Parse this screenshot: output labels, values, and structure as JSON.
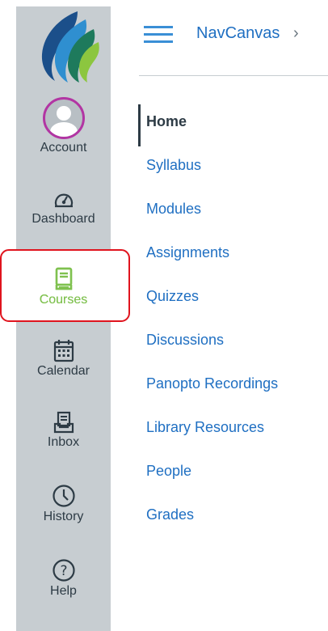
{
  "global_nav": {
    "account": {
      "label": "Account",
      "icon": "avatar-icon"
    },
    "dashboard": {
      "label": "Dashboard",
      "icon": "speedometer-icon"
    },
    "courses": {
      "label": "Courses",
      "icon": "book-icon"
    },
    "calendar": {
      "label": "Calendar",
      "icon": "calendar-icon"
    },
    "inbox": {
      "label": "Inbox",
      "icon": "inbox-icon"
    },
    "history": {
      "label": "History",
      "icon": "clock-icon"
    },
    "help": {
      "label": "Help",
      "icon": "question-icon"
    }
  },
  "header": {
    "breadcrumb": "NavCanvas",
    "separator": "›"
  },
  "course_nav": {
    "items": [
      {
        "label": "Home",
        "active": true
      },
      {
        "label": "Syllabus"
      },
      {
        "label": "Modules"
      },
      {
        "label": "Assignments"
      },
      {
        "label": "Quizzes"
      },
      {
        "label": "Discussions"
      },
      {
        "label": "Panopto Recordings"
      },
      {
        "label": "Library Resources"
      },
      {
        "label": "People"
      },
      {
        "label": "Grades"
      }
    ]
  },
  "colors": {
    "nav_background": "#c7cdd1",
    "active_course": "#7fc14f",
    "link": "#1f6fc2",
    "highlight_border": "#e0141e"
  }
}
